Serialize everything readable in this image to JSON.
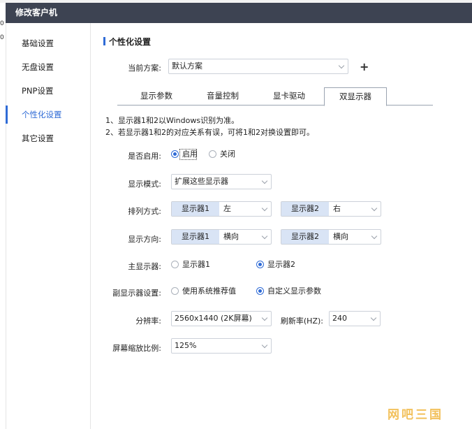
{
  "window": {
    "title": "修改客户机",
    "edge_chars": [
      "0",
      "0"
    ]
  },
  "sidebar": {
    "items": [
      {
        "label": "基础设置"
      },
      {
        "label": "无盘设置"
      },
      {
        "label": "PNP设置"
      },
      {
        "label": "个性化设置",
        "active": true
      },
      {
        "label": "其它设置"
      }
    ]
  },
  "section": {
    "title": "个性化设置"
  },
  "scheme": {
    "label": "当前方案:",
    "value": "默认方案",
    "add_icon": "+"
  },
  "tabs": [
    {
      "label": "显示参数"
    },
    {
      "label": "音量控制"
    },
    {
      "label": "显卡驱动"
    },
    {
      "label": "双显示器",
      "active": true
    }
  ],
  "notes": [
    "1、显示器1和2以Windows识别为准。",
    "2、若显示器1和2的对应关系有误，可将1和2对换设置即可。"
  ],
  "form": {
    "enable": {
      "label": "是否启用:",
      "options": [
        "启用",
        "关闭"
      ],
      "selected": "启用"
    },
    "mode": {
      "label": "显示模式:",
      "value": "扩展这些显示器"
    },
    "arrange": {
      "label": "排列方式:",
      "monitor1": {
        "tag": "显示器1",
        "value": "左"
      },
      "monitor2": {
        "tag": "显示器2",
        "value": "右"
      }
    },
    "orientation": {
      "label": "显示方向:",
      "monitor1": {
        "tag": "显示器1",
        "value": "横向"
      },
      "monitor2": {
        "tag": "显示器2",
        "value": "横向"
      }
    },
    "primary": {
      "label": "主显示器:",
      "options": [
        "显示器1",
        "显示器2"
      ],
      "selected": "显示器2"
    },
    "secondary": {
      "label": "副显示器设置:",
      "options": [
        "使用系统推荐值",
        "自定义显示参数"
      ],
      "selected": "自定义显示参数"
    },
    "resolution": {
      "label": "分辨率:",
      "value": "2560x1440 (2K屏幕)"
    },
    "refresh": {
      "label": "刷新率(HZ):",
      "value": "240"
    },
    "scale": {
      "label": "屏幕缩放比例:",
      "value": "125%"
    }
  },
  "watermark": {
    "text": "网吧三国"
  },
  "colors": {
    "accent": "#2f6bd6",
    "titlebar": "#3d4352",
    "tag_bg": "#d9e4f5",
    "watermark": "#f2c15c"
  }
}
